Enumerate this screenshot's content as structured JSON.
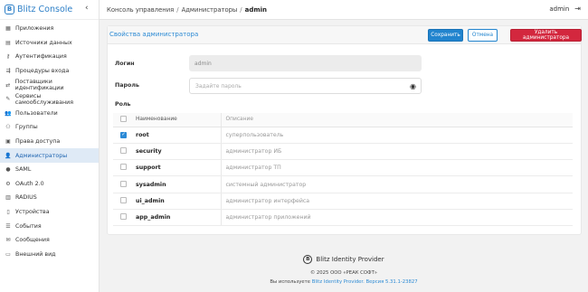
{
  "brand": {
    "logo_letter": "B",
    "name": "Blitz Console",
    "collapse_icon": "chevron-left-icon"
  },
  "sidebar": {
    "items": [
      {
        "label": "Приложения",
        "icon": "apps-icon",
        "glyph": "▦"
      },
      {
        "label": "Источники данных",
        "icon": "database-icon",
        "glyph": "▤"
      },
      {
        "label": "Аутентификация",
        "icon": "key-icon",
        "glyph": "⚷"
      },
      {
        "label": "Процедуры входа",
        "icon": "login-flow-icon",
        "glyph": "⇶"
      },
      {
        "label": "Поставщики идентификации",
        "icon": "provider-icon",
        "glyph": "⇄"
      },
      {
        "label": "Сервисы самообслуживания",
        "icon": "wrench-icon",
        "glyph": "✎"
      },
      {
        "label": "Пользователи",
        "icon": "users-icon",
        "glyph": "👥"
      },
      {
        "label": "Группы",
        "icon": "groups-icon",
        "glyph": "⚇"
      },
      {
        "label": "Права доступа",
        "icon": "access-rights-icon",
        "glyph": "▣"
      },
      {
        "label": "Администраторы",
        "icon": "admin-icon",
        "glyph": "👤",
        "active": true
      },
      {
        "label": "SAML",
        "icon": "saml-icon",
        "glyph": "●"
      },
      {
        "label": "OAuth 2.0",
        "icon": "oauth-icon",
        "glyph": "⚙"
      },
      {
        "label": "RADIUS",
        "icon": "radius-icon",
        "glyph": "▥"
      },
      {
        "label": "Устройства",
        "icon": "devices-icon",
        "glyph": "▯"
      },
      {
        "label": "События",
        "icon": "events-icon",
        "glyph": "☰"
      },
      {
        "label": "Сообщения",
        "icon": "messages-icon",
        "glyph": "✉"
      },
      {
        "label": "Внешний вид",
        "icon": "appearance-icon",
        "glyph": "▭"
      }
    ]
  },
  "breadcrumb": {
    "items": [
      "Консоль управления",
      "Администраторы"
    ],
    "current": "admin"
  },
  "user": {
    "name": "admin",
    "logout_icon": "logout-icon"
  },
  "card": {
    "title": "Свойства администратора",
    "save_label": "Сохранить",
    "cancel_label": "Отмена",
    "delete_label": "Удалить администратора"
  },
  "form": {
    "login_label": "Логин",
    "login_value": "admin",
    "password_label": "Пароль",
    "password_placeholder": "Задайте пароль",
    "role_label": "Роль"
  },
  "roles": {
    "headers": {
      "name": "Наименование",
      "description": "Описание"
    },
    "rows": [
      {
        "name": "root",
        "description": "суперпользователь",
        "checked": true
      },
      {
        "name": "security",
        "description": "администратор ИБ",
        "checked": false
      },
      {
        "name": "support",
        "description": "администратор ТП",
        "checked": false
      },
      {
        "name": "sysadmin",
        "description": "системный администратор",
        "checked": false
      },
      {
        "name": "ui_admin",
        "description": "администратор интерфейса",
        "checked": false
      },
      {
        "name": "app_admin",
        "description": "администратор приложений",
        "checked": false
      }
    ]
  },
  "footer": {
    "product": "Blitz Identity Provider",
    "copyright": "© 2025 ООО «РЕАК СОФТ»",
    "version_prefix": "Вы используете",
    "version_link": "Blitz Identity Provider. Версия 5.31.1-23827"
  },
  "colors": {
    "accent": "#2184ce",
    "danger": "#d3273e",
    "active_bg": "#dfeaf6"
  }
}
